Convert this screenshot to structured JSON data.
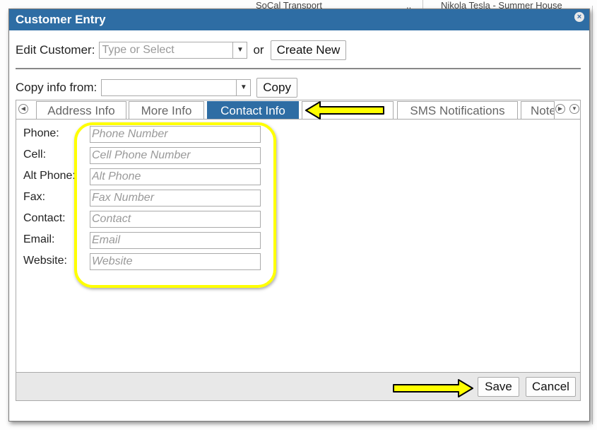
{
  "background": {
    "company": "SoCal Transport",
    "ellipsis": "..",
    "location": "Nikola Tesla - Summer House"
  },
  "dialog": {
    "title": "Customer Entry",
    "close_glyph": "×"
  },
  "edit_customer": {
    "label": "Edit Customer:",
    "placeholder": "Type or Select",
    "or_text": "or",
    "create_new_label": "Create New"
  },
  "copy_info": {
    "label": "Copy info from:",
    "value": "",
    "copy_label": "Copy"
  },
  "tabs": [
    {
      "label": "Address Info",
      "active": false
    },
    {
      "label": "More Info",
      "active": false
    },
    {
      "label": "Contact Info",
      "active": true
    },
    {
      "label": "",
      "active": false
    },
    {
      "label": "SMS Notifications",
      "active": false
    },
    {
      "label": "Note",
      "active": false
    }
  ],
  "contact_fields": [
    {
      "label": "Phone:",
      "placeholder": "Phone Number",
      "value": ""
    },
    {
      "label": "Cell:",
      "placeholder": "Cell Phone Number",
      "value": ""
    },
    {
      "label": "Alt Phone:",
      "placeholder": "Alt Phone",
      "value": ""
    },
    {
      "label": "Fax:",
      "placeholder": "Fax Number",
      "value": ""
    },
    {
      "label": "Contact:",
      "placeholder": "Contact",
      "value": ""
    },
    {
      "label": "Email:",
      "placeholder": "Email",
      "value": ""
    },
    {
      "label": "Website:",
      "placeholder": "Website",
      "value": ""
    }
  ],
  "footer": {
    "save_label": "Save",
    "cancel_label": "Cancel"
  },
  "icons": {
    "tab_prev": "chevron-left-icon",
    "tab_next": "chevron-right-icon",
    "tab_menu": "chevron-down-icon",
    "dropdown": "caret-down-icon",
    "annotation": "arrow-right-icon"
  },
  "colors": {
    "titlebar": "#2e6da4",
    "active_tab": "#2e6da4",
    "highlight": "#ffff00",
    "footer_bg": "#e8e8e8"
  }
}
